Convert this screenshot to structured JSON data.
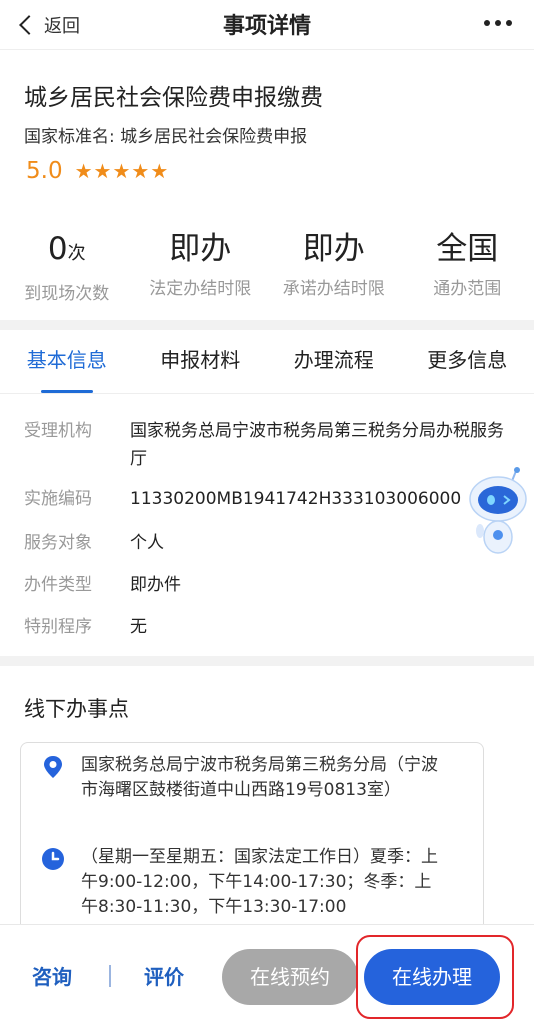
{
  "header": {
    "back_label": "返回",
    "title": "事项详情"
  },
  "item": {
    "name": "城乡居民社会保险费申报缴费",
    "standard_name": "国家标准名: 城乡居民社会保险费申报",
    "rating_score": "5.0",
    "stars": 5
  },
  "stats": [
    {
      "value": "0",
      "unit": "次",
      "label": "到现场次数"
    },
    {
      "value": "即办",
      "unit": "",
      "label": "法定办结时限"
    },
    {
      "value": "即办",
      "unit": "",
      "label": "承诺办结时限"
    },
    {
      "value": "全国",
      "unit": "",
      "label": "通办范围"
    }
  ],
  "tabs": [
    "基本信息",
    "申报材料",
    "办理流程",
    "更多信息"
  ],
  "basic_info": [
    {
      "key": "受理机构",
      "value": "国家税务总局宁波市税务局第三税务分局办税服务厅"
    },
    {
      "key": "实施编码",
      "value": "11330200MB1941742H333103006000"
    },
    {
      "key": "服务对象",
      "value": "个人"
    },
    {
      "key": "办件类型",
      "value": "即办件"
    },
    {
      "key": "特别程序",
      "value": "无"
    }
  ],
  "offline": {
    "title": "线下办事点",
    "address": "国家税务总局宁波市税务局第三税务分局（宁波市海曙区鼓楼街道中山西路19号0813室）",
    "hours": "（星期一至星期五：国家法定工作日）夏季：上午9:00-12:00，下午14:00-17:30；冬季：上午8:30-11:30，下午13:30-17:00"
  },
  "bottom_bar": {
    "consult": "咨询",
    "separator": "|",
    "evaluate": "评价",
    "reserve": "在线预约",
    "apply": "在线办理"
  },
  "colors": {
    "accent": "#2563dc",
    "star": "#f08c1a",
    "highlight": "#e2262a"
  }
}
